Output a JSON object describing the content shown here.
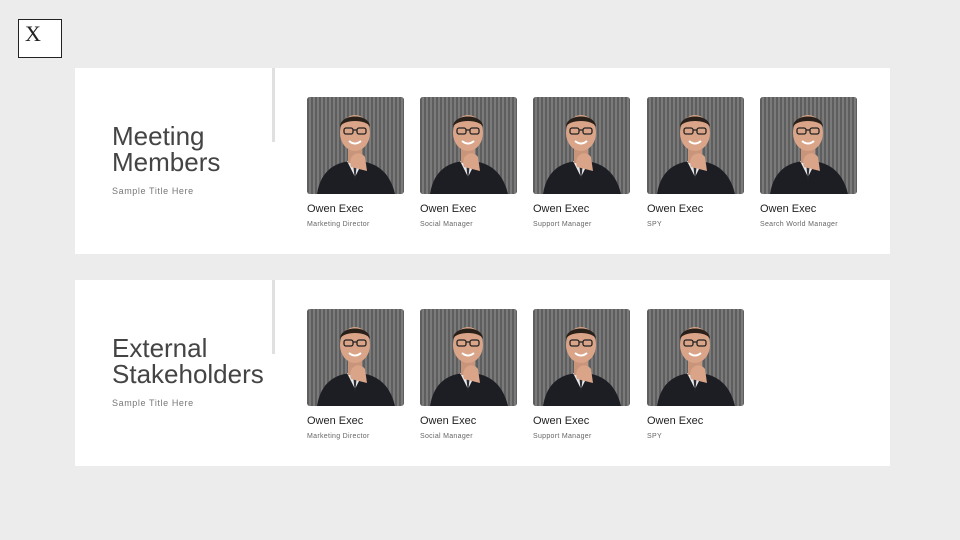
{
  "logo": {
    "letter": "X"
  },
  "sections": [
    {
      "title": "Meeting Members",
      "subtitle": "Sample Title Here",
      "members": [
        {
          "name": "Owen Exec",
          "role": "Marketing Director"
        },
        {
          "name": "Owen Exec",
          "role": "Social Manager"
        },
        {
          "name": "Owen Exec",
          "role": "Support Manager"
        },
        {
          "name": "Owen Exec",
          "role": "SPY"
        },
        {
          "name": "Owen Exec",
          "role": "Search World Manager"
        }
      ]
    },
    {
      "title": "External Stakeholders",
      "subtitle": "Sample Title Here",
      "members": [
        {
          "name": "Owen Exec",
          "role": "Marketing Director"
        },
        {
          "name": "Owen Exec",
          "role": "Social Manager"
        },
        {
          "name": "Owen Exec",
          "role": "Support Manager"
        },
        {
          "name": "Owen Exec",
          "role": "SPY"
        }
      ]
    }
  ]
}
